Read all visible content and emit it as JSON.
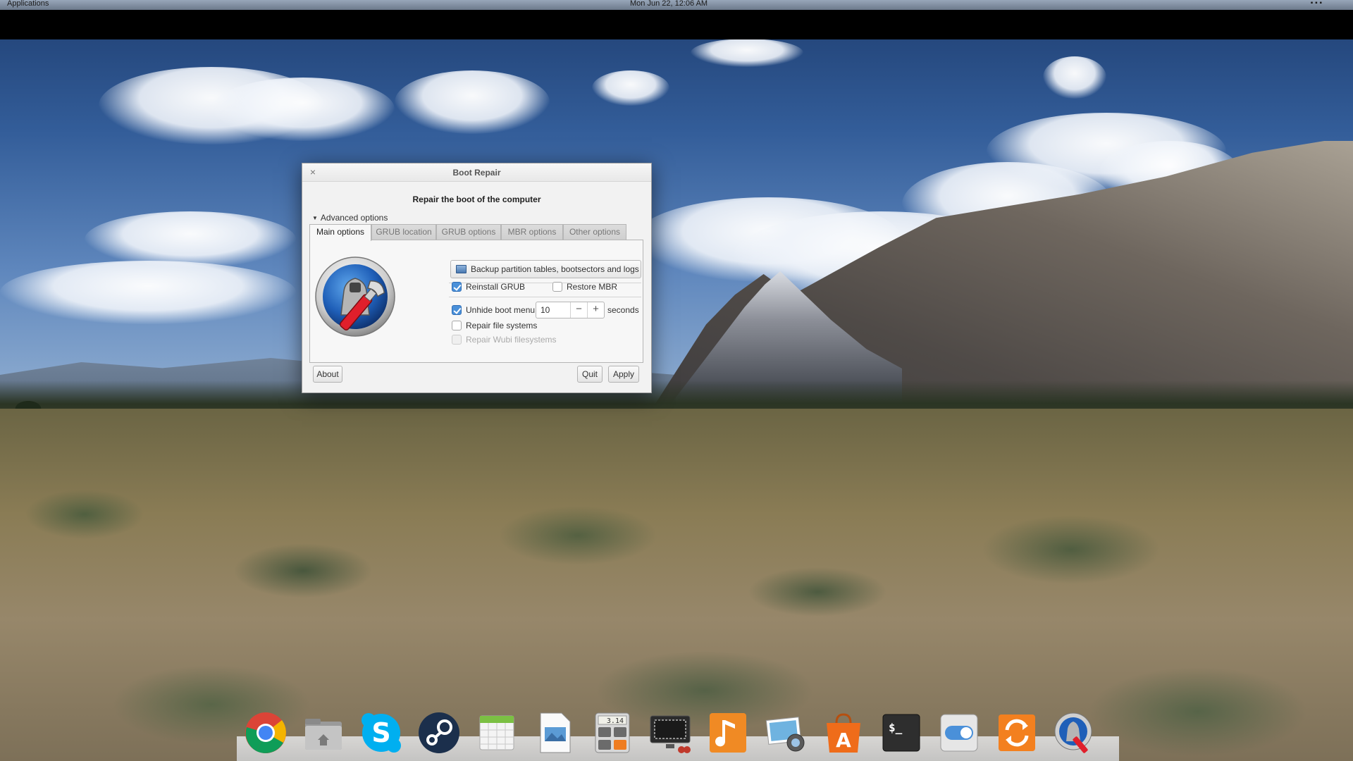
{
  "top_panel": {
    "applications_label": "Applications",
    "clock": "Mon Jun 22, 12:06 AM"
  },
  "dialog": {
    "title": "Boot Repair",
    "close_symbol": "×",
    "heading": "Repair the boot of the computer",
    "advanced_label": "Advanced options",
    "advanced_arrow": "▼",
    "tabs": [
      {
        "label": "Main options",
        "active": true
      },
      {
        "label": "GRUB location",
        "active": false
      },
      {
        "label": "GRUB options",
        "active": false
      },
      {
        "label": "MBR options",
        "active": false
      },
      {
        "label": "Other options",
        "active": false
      }
    ],
    "main_options": {
      "backup_label": "Backup partition tables, bootsectors and logs",
      "reinstall_grub": {
        "label": "Reinstall GRUB",
        "checked": true
      },
      "restore_mbr": {
        "label": "Restore MBR",
        "checked": false
      },
      "unhide_boot_menu": {
        "label": "Unhide boot menu :",
        "checked": true
      },
      "unhide_seconds_value": "10",
      "seconds_label": "seconds",
      "spin_minus": "−",
      "spin_plus": "+",
      "repair_fs": {
        "label": "Repair file systems",
        "checked": false
      },
      "repair_wubi": {
        "label": "Repair Wubi filesystems",
        "checked": false,
        "disabled": true
      }
    },
    "buttons": {
      "about": "About",
      "quit": "Quit",
      "apply": "Apply"
    }
  },
  "dock": {
    "items": [
      {
        "icon": "chrome-icon"
      },
      {
        "icon": "files-icon"
      },
      {
        "icon": "skype-icon"
      },
      {
        "icon": "steam-icon"
      },
      {
        "icon": "calendar-icon"
      },
      {
        "icon": "document-viewer-icon"
      },
      {
        "icon": "calculator-icon",
        "text": "3.14"
      },
      {
        "icon": "screenshot-icon"
      },
      {
        "icon": "music-icon"
      },
      {
        "icon": "photos-icon"
      },
      {
        "icon": "software-center-icon"
      },
      {
        "icon": "terminal-icon",
        "text": "$_"
      },
      {
        "icon": "switchboard-icon"
      },
      {
        "icon": "update-manager-icon"
      },
      {
        "icon": "boot-repair-icon"
      }
    ]
  },
  "colors": {
    "panel": "#000000",
    "accent": "#4a90d9",
    "dialog_bg": "#f2f2f2"
  }
}
